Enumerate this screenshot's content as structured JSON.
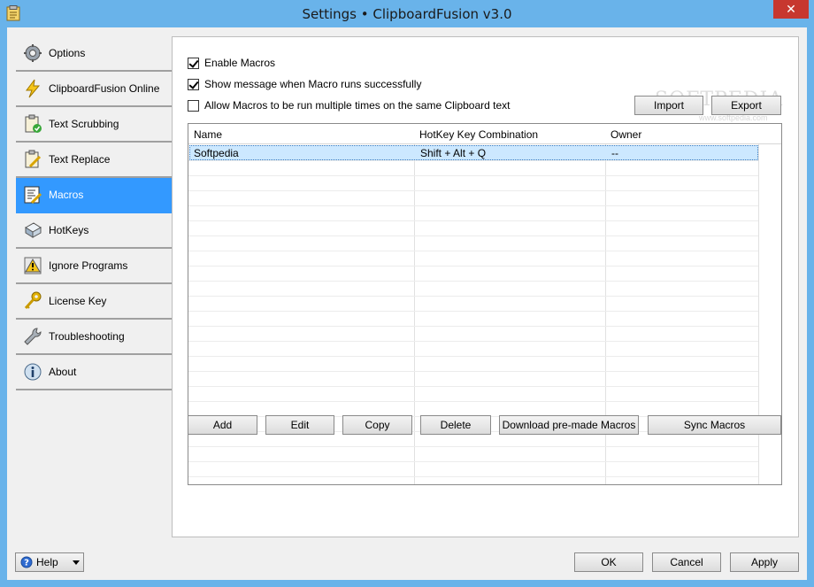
{
  "window": {
    "title": "Settings • ClipboardFusion v3.0",
    "close_glyph": "✕"
  },
  "sidebar": {
    "items": [
      {
        "label": "Options",
        "icon": "gear-icon"
      },
      {
        "label": "ClipboardFusion Online",
        "icon": "lightning-icon"
      },
      {
        "label": "Text Scrubbing",
        "icon": "clipboard-check-icon"
      },
      {
        "label": "Text Replace",
        "icon": "clipboard-edit-icon"
      },
      {
        "label": "Macros",
        "icon": "macro-script-icon",
        "active": true
      },
      {
        "label": "HotKeys",
        "icon": "keyboard-key-icon"
      },
      {
        "label": "Ignore Programs",
        "icon": "warning-icon"
      },
      {
        "label": "License Key",
        "icon": "key-icon"
      },
      {
        "label": "Troubleshooting",
        "icon": "wrench-icon"
      },
      {
        "label": "About",
        "icon": "info-icon"
      }
    ]
  },
  "macros": {
    "enable_label": "Enable Macros",
    "enable_checked": true,
    "show_message_label": "Show message when Macro runs successfully",
    "show_message_checked": true,
    "allow_multiple_label": "Allow Macros to be run multiple times on the same Clipboard text",
    "allow_multiple_checked": false,
    "import_label": "Import",
    "export_label": "Export",
    "watermark": "SOFTPEDIA",
    "watermark_sub": "www.softpedia.com",
    "table": {
      "columns": [
        "Name",
        "HotKey Key Combination",
        "Owner"
      ],
      "rows": [
        [
          "Softpedia",
          "Shift + Alt + Q",
          "--"
        ]
      ]
    },
    "buttons": {
      "add": "Add",
      "edit": "Edit",
      "copy": "Copy",
      "delete": "Delete",
      "download": "Download pre-made Macros",
      "sync": "Sync Macros"
    }
  },
  "footer": {
    "help_label": "Help",
    "ok_label": "OK",
    "cancel_label": "Cancel",
    "apply_label": "Apply"
  },
  "colors": {
    "title_bar": "#69b3ea",
    "selected_nav": "#3399ff",
    "close_button": "#c7372f",
    "selected_row": "#cce8ff"
  }
}
